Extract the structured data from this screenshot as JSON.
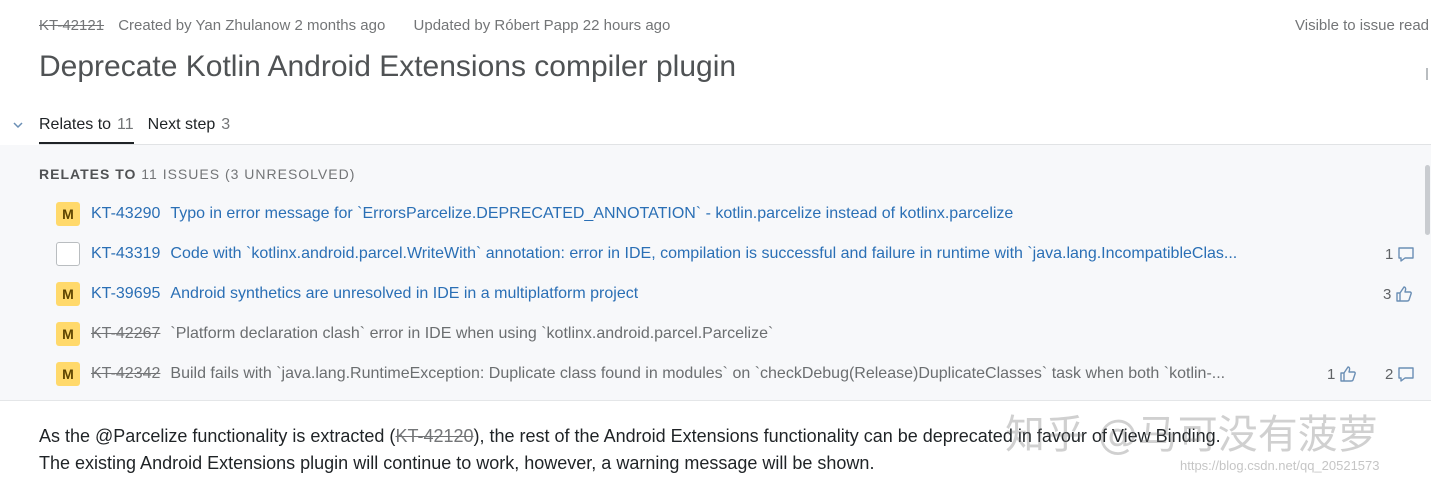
{
  "issue": {
    "id": "KT-42121",
    "created": "Created by Yan Zhulanow 2 months ago",
    "updated": "Updated by Róbert Papp 22 hours ago",
    "visibility": "Visible to issue read",
    "title": "Deprecate Kotlin Android Extensions compiler plugin"
  },
  "tabs": [
    {
      "label": "Relates to",
      "count": "11",
      "active": true
    },
    {
      "label": "Next step",
      "count": "3",
      "active": false
    }
  ],
  "section": {
    "title": "RELATES TO",
    "count": "11 ISSUES (3 UNRESOLVED)"
  },
  "issues": [
    {
      "priority": "M",
      "key": "KT-43290",
      "resolved": false,
      "summary": "Typo in error message for `ErrorsParcelize.DEPRECATED_ANNOTATION` - kotlin.parcelize instead of kotlinx.parcelize",
      "votes": "",
      "comments": ""
    },
    {
      "priority": "",
      "key": "KT-43319",
      "resolved": false,
      "summary": "Code with `kotlinx.android.parcel.WriteWith` annotation: error in IDE, compilation is successful and failure in runtime with `java.lang.IncompatibleClas...",
      "votes": "",
      "comments": "1"
    },
    {
      "priority": "M",
      "key": "KT-39695",
      "resolved": false,
      "summary": "Android synthetics are unresolved in IDE in a multiplatform project",
      "votes": "3",
      "comments": ""
    },
    {
      "priority": "M",
      "key": "KT-42267",
      "resolved": true,
      "summary": "`Platform declaration clash` error in IDE when using `kotlinx.android.parcel.Parcelize`",
      "votes": "",
      "comments": ""
    },
    {
      "priority": "M",
      "key": "KT-42342",
      "resolved": true,
      "summary": "Build fails with `java.lang.RuntimeException: Duplicate class found in modules` on `checkDebug(Release)DuplicateClasses` task when both `kotlin-...",
      "votes": "1",
      "comments": "2"
    }
  ],
  "description": {
    "line1_before": "As the @Parcelize functionality is extracted (",
    "line1_ref": "KT-42120",
    "line1_after": "), the rest of the Android Extensions functionality can be deprecated in favour of View Binding.",
    "line2": "The existing Android Extensions plugin will continue to work, however, a warning message will be shown."
  },
  "watermark": {
    "text": "知乎 @马可没有菠萝",
    "url": "https://blog.csdn.net/qq_20521573"
  },
  "colors": {
    "link": "#2a6fb5",
    "priority_major": "#ffd96b",
    "panel_bg": "#f7f8fa",
    "muted": "#737577"
  },
  "icons": {
    "collapse": "chevron-down-icon",
    "votes": "thumbs-up-icon",
    "comments": "comment-icon"
  }
}
